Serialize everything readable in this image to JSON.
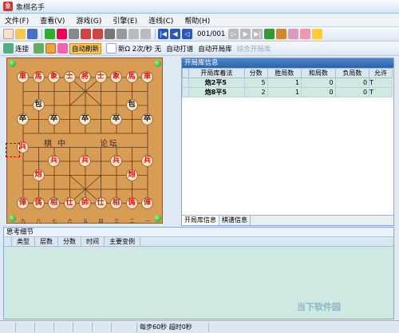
{
  "window": {
    "title": "象棋名手"
  },
  "menu": [
    "文件(F)",
    "查看(V)",
    "游戏(G)",
    "引擎(E)",
    "连线(C)",
    "帮助(H)"
  ],
  "toolbar1": {
    "page": "001/001"
  },
  "toolbar2": {
    "connect": "连接",
    "auto_refresh": "自动刷新",
    "speed": "新Ω  2次/秒  无",
    "auto_play": "自动打谱",
    "auto_open_lib": "自动开局库",
    "combined_lib": "综合开局库"
  },
  "board": {
    "river_left": "棋  中",
    "river_right": "论坛",
    "red_files": [
      "九",
      "八",
      "七",
      "六",
      "五",
      "四",
      "三",
      "二",
      "一"
    ]
  },
  "pieces": [
    {
      "ch": "車",
      "side": "red",
      "file": 0,
      "rank": 0
    },
    {
      "ch": "馬",
      "side": "red",
      "file": 1,
      "rank": 0
    },
    {
      "ch": "象",
      "side": "red",
      "file": 2,
      "rank": 0
    },
    {
      "ch": "士",
      "side": "red",
      "file": 3,
      "rank": 0
    },
    {
      "ch": "將",
      "side": "red",
      "file": 4,
      "rank": 0
    },
    {
      "ch": "士",
      "side": "red",
      "file": 5,
      "rank": 0
    },
    {
      "ch": "象",
      "side": "red",
      "file": 6,
      "rank": 0
    },
    {
      "ch": "馬",
      "side": "red",
      "file": 7,
      "rank": 0
    },
    {
      "ch": "車",
      "side": "red",
      "file": 8,
      "rank": 0
    },
    {
      "ch": "包",
      "side": "black",
      "file": 1,
      "rank": 2
    },
    {
      "ch": "包",
      "side": "black",
      "file": 7,
      "rank": 2
    },
    {
      "ch": "卒",
      "side": "black",
      "file": 0,
      "rank": 3
    },
    {
      "ch": "卒",
      "side": "black",
      "file": 2,
      "rank": 3
    },
    {
      "ch": "卒",
      "side": "black",
      "file": 4,
      "rank": 3
    },
    {
      "ch": "卒",
      "side": "black",
      "file": 6,
      "rank": 3
    },
    {
      "ch": "卒",
      "side": "black",
      "file": 8,
      "rank": 3
    },
    {
      "ch": "兵",
      "side": "red",
      "file": 0,
      "rank": 5
    },
    {
      "ch": "兵",
      "side": "red",
      "file": 2,
      "rank": 6
    },
    {
      "ch": "兵",
      "side": "red",
      "file": 4,
      "rank": 6
    },
    {
      "ch": "兵",
      "side": "red",
      "file": 6,
      "rank": 6
    },
    {
      "ch": "兵",
      "side": "red",
      "file": 8,
      "rank": 6
    },
    {
      "ch": "炮",
      "side": "red",
      "file": 1,
      "rank": 7
    },
    {
      "ch": "炮",
      "side": "red",
      "file": 7,
      "rank": 7
    },
    {
      "ch": "俥",
      "side": "red",
      "file": 0,
      "rank": 9
    },
    {
      "ch": "傌",
      "side": "red",
      "file": 1,
      "rank": 9
    },
    {
      "ch": "相",
      "side": "red",
      "file": 2,
      "rank": 9
    },
    {
      "ch": "仕",
      "side": "red",
      "file": 3,
      "rank": 9
    },
    {
      "ch": "帥",
      "side": "red",
      "file": 4,
      "rank": 9
    },
    {
      "ch": "仕",
      "side": "red",
      "file": 5,
      "rank": 9
    },
    {
      "ch": "相",
      "side": "red",
      "file": 6,
      "rank": 9
    },
    {
      "ch": "傌",
      "side": "red",
      "file": 7,
      "rank": 9
    },
    {
      "ch": "俥",
      "side": "red",
      "file": 8,
      "rank": 9
    }
  ],
  "opening_lib": {
    "title": "开局库信息",
    "columns": [
      "开局库着法",
      "分数",
      "胜局数",
      "和局数",
      "负局数",
      "允许"
    ],
    "rows": [
      {
        "move": "炮2平5",
        "score": "5",
        "win": "1",
        "draw": "0",
        "loss": "0",
        "allow": "T"
      },
      {
        "move": "炮8平5",
        "score": "2",
        "win": "1",
        "draw": "0",
        "loss": "0",
        "allow": "T"
      }
    ],
    "tabs": [
      "开局库信息",
      "棋谱信息"
    ]
  },
  "thinking": {
    "title": "思考细节",
    "columns": [
      "类型",
      "层数",
      "分数",
      "时间",
      "主要变例"
    ]
  },
  "status": {
    "time_control": "每步60秒  超时0秒"
  },
  "watermark": "当下软件园",
  "colors": {
    "board": "#d89c55",
    "table_bg": "#cfe8e1",
    "header_blue": "#2e62a8"
  }
}
